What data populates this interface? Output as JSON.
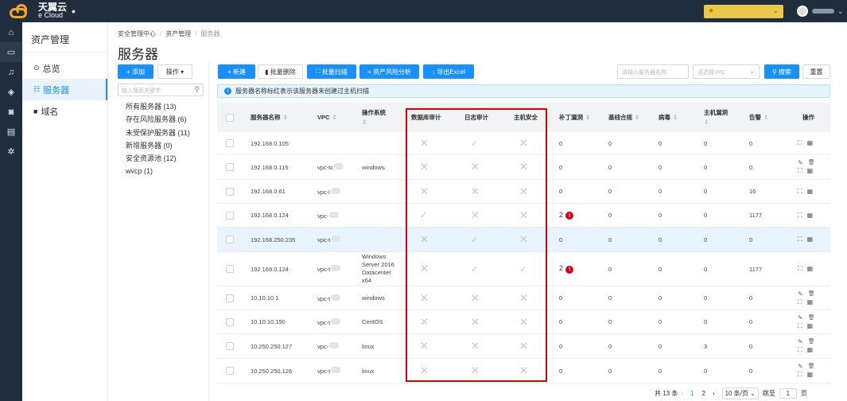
{
  "brand": {
    "name": "天翼云",
    "sub": "e Cloud"
  },
  "sidebar": {
    "title": "资产管理",
    "items": [
      {
        "label": "总览",
        "icon": "overview-icon"
      },
      {
        "label": "服务器",
        "icon": "server-grid-icon"
      },
      {
        "label": "域名",
        "icon": "domain-icon"
      }
    ]
  },
  "breadcrumb": [
    "安全管理中心",
    "资产管理",
    "服务器"
  ],
  "page_title": "服务器",
  "left_toolbar": {
    "add": "添加",
    "ops": "操作"
  },
  "tree": {
    "search_placeholder": "输入搜索关键字",
    "items": [
      "所有服务器 (13)",
      "存在风险服务器 (6)",
      "未受保护服务器 (11)",
      "新增服务器 (0)",
      "安全资源池 (12)",
      "wvcp (1)"
    ]
  },
  "toolbar": {
    "new": "新建",
    "batch_delete": "批量删除",
    "batch_scan": "批量扫描",
    "risk_analysis": "资产风险分析",
    "export": "导出Excel",
    "search_placeholder": "请输入服务器名称",
    "vpc_placeholder": "请选择VPC",
    "search": "搜索",
    "reset": "重置"
  },
  "notice": "服务器名称标红表示该服务器未创建过主机扫描",
  "columns": {
    "name": "服务器名称",
    "vpc": "VPC",
    "os": "操作系统",
    "db_audit": "数据库审计",
    "log_audit": "日志审计",
    "host_sec": "主机安全",
    "patch": "补丁漏洞",
    "baseline": "基线合规",
    "virus": "病毒",
    "host_vuln": "主机漏洞",
    "alerts": "告警",
    "ops": "操作"
  },
  "rows": [
    {
      "name": "192.168.0.105",
      "vpc": "",
      "os": "",
      "db": "x",
      "log": "v",
      "host": "x",
      "patch": "0",
      "baseline": "0",
      "virus": "0",
      "vuln": "0",
      "alerts": "0"
    },
    {
      "name": "192.168.0.115",
      "vpc": "vpc-tc",
      "os": "windows",
      "db": "x",
      "log": "x",
      "host": "x",
      "patch": "0",
      "baseline": "0",
      "virus": "0",
      "vuln": "0",
      "alerts": "0"
    },
    {
      "name": "192.168.0.61",
      "vpc": "vpc-l",
      "os": "",
      "db": "x",
      "log": "x",
      "host": "x",
      "patch": "0",
      "baseline": "0",
      "virus": "0",
      "vuln": "0",
      "alerts": "16"
    },
    {
      "name": "192.168.0.124",
      "vpc": "vpc-",
      "os": "",
      "db": "v",
      "log": "x",
      "host": "x",
      "patch": "2",
      "baseline": "0",
      "virus": "0",
      "vuln": "0",
      "alerts": "1177"
    },
    {
      "name": "192.168.250.235",
      "vpc": "vpc-t",
      "os": "",
      "db": "x",
      "log": "v",
      "host": "x",
      "patch": "0",
      "baseline": "0",
      "virus": "0",
      "vuln": "0",
      "alerts": "0"
    },
    {
      "name": "192.168.0.124",
      "vpc": "vpc-t",
      "os": "Windows Server 2016 Datacenter x64",
      "db": "x",
      "log": "v",
      "host": "v",
      "patch": "2",
      "baseline": "0",
      "virus": "0",
      "vuln": "0",
      "alerts": "1177"
    },
    {
      "name": "10.10.10.1",
      "vpc": "vpc-t",
      "os": "windows",
      "db": "x",
      "log": "x",
      "host": "x",
      "patch": "0",
      "baseline": "0",
      "virus": "0",
      "vuln": "0",
      "alerts": "0"
    },
    {
      "name": "10.10.10.190",
      "vpc": "vpc-t",
      "os": "CentOS",
      "db": "x",
      "log": "x",
      "host": "x",
      "patch": "0",
      "baseline": "0",
      "virus": "0",
      "vuln": "0",
      "alerts": "0"
    },
    {
      "name": "10.250.250.127",
      "vpc": "vpc-",
      "os": "linux",
      "db": "x",
      "log": "x",
      "host": "x",
      "patch": "0",
      "baseline": "0",
      "virus": "0",
      "vuln": "3",
      "alerts": "0"
    },
    {
      "name": "10.250.250.126",
      "vpc": "vpc-t",
      "os": "linux",
      "db": "x",
      "log": "x",
      "host": "x",
      "patch": "0",
      "baseline": "0",
      "virus": "0",
      "vuln": "0",
      "alerts": "0"
    }
  ],
  "pagination": {
    "total": "共 13 条",
    "pages": [
      "1",
      "2"
    ],
    "page_size": "10 条/页",
    "jump_label": "跳至",
    "jump_value": "1",
    "page_suffix": "页"
  },
  "colors": {
    "primary": "#1890ff",
    "highlight_box": "#e00000",
    "danger": "#d9001b"
  }
}
